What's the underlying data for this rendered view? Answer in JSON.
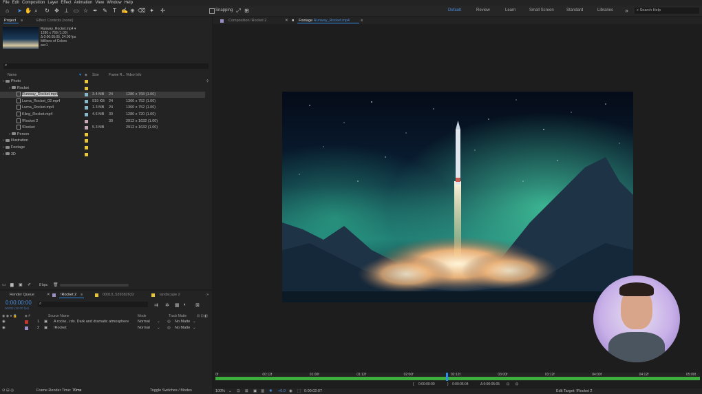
{
  "menu": [
    "File",
    "Edit",
    "Composition",
    "Layer",
    "Effect",
    "Animation",
    "View",
    "Window",
    "Help"
  ],
  "toolbar": {
    "snapping_label": "Snapping"
  },
  "workspaces": [
    "Default",
    "Review",
    "Learn",
    "Small Screen",
    "Standard",
    "Libraries"
  ],
  "search_help": "Search Help",
  "project_panel": {
    "tab_project": "Project",
    "tab_effect_controls": "Effect Controls (none)",
    "thumb_info": [
      "Runway_Rocket.mp4 ▾",
      "1280 x 768 (1.00)",
      "Δ 0:00:05:05, 24.00 fps",
      "Millions of Colors",
      "avc1"
    ],
    "columns": {
      "name": "Name",
      "size": "Size",
      "frame_rate": "Frame R...",
      "video_info": "Video Info"
    },
    "items": [
      {
        "name": "Photo",
        "type": "folder",
        "indent": 0,
        "size": "",
        "fr": "",
        "vi": "",
        "label": "#e8c53a"
      },
      {
        "name": "Rocket",
        "type": "folder",
        "indent": 1,
        "size": "",
        "fr": "",
        "vi": "",
        "label": "#e8c53a"
      },
      {
        "name": "Runway_Rocket.mp4",
        "type": "file",
        "indent": 2,
        "size": "3.4 MB",
        "fr": "24",
        "vi": "1280 x 768 (1.00)",
        "label": "#88b8c8",
        "selected": true
      },
      {
        "name": "Luma_Rocket_02.mp4",
        "type": "file",
        "indent": 2,
        "size": "919 KB",
        "fr": "24",
        "vi": "1360 x 752 (1.00)",
        "label": "#88b8c8"
      },
      {
        "name": "Luma_Rocket.mp4",
        "type": "file",
        "indent": 2,
        "size": "1.3 MB",
        "fr": "24",
        "vi": "1360 x 752 (1.00)",
        "label": "#88b8c8"
      },
      {
        "name": "Kling_Rocket.mp4",
        "type": "file",
        "indent": 2,
        "size": "4.6 MB",
        "fr": "30",
        "vi": "1280 x 720 (1.00)",
        "label": "#88b8c8"
      },
      {
        "name": "!Rocket 2",
        "type": "file",
        "indent": 2,
        "size": "",
        "fr": "30",
        "vi": "2912 x 1632 (1.00)",
        "label": "#c8a8b8"
      },
      {
        "name": "!Rocket",
        "type": "file",
        "indent": 2,
        "size": "5.3 MB",
        "fr": "",
        "vi": "2912 x 1632 (1.00)",
        "label": "#c8a8b8"
      },
      {
        "name": "Person",
        "type": "folder",
        "indent": 1,
        "size": "",
        "fr": "",
        "vi": "",
        "label": "#e8c53a"
      },
      {
        "name": "Illustration",
        "type": "folder",
        "indent": 0,
        "size": "",
        "fr": "",
        "vi": "",
        "label": "#e8c53a"
      },
      {
        "name": "Footage",
        "type": "folder",
        "indent": 0,
        "size": "",
        "fr": "",
        "vi": "",
        "label": "#e8c53a"
      },
      {
        "name": "3D",
        "type": "folder",
        "indent": 0,
        "size": "",
        "fr": "",
        "vi": "",
        "label": "#e8c53a"
      }
    ],
    "bpc": "8 bpc"
  },
  "viewer": {
    "tab_composition": "Composition !Rocket 2",
    "tab_footage_prefix": "Footage",
    "tab_footage_name": "Runway_Rocket.mp4",
    "ruler_labels": [
      "0f",
      "00:12f",
      "01:00f",
      "01:12f",
      "02:00f",
      "02:12f",
      "03:00f",
      "03:12f",
      "04:00f",
      "04:12f",
      "05:00f"
    ],
    "in_point": "0:00:00:00",
    "out_point": "0:00:05:04",
    "duration": "Δ 0:00:05:05",
    "zoom": "100%",
    "timecode": "0:00:02:07",
    "edit_target": "Edit Target: !Rocket 2"
  },
  "timeline": {
    "tab_render_queue": "Render Queue",
    "tab_rocket2": "!Rocket 2",
    "tab_00010": "00010_539382632",
    "tab_landscape": "landscape 2",
    "timecode": "0:00:00:00",
    "timecode_sub": "00000 (30.00 fps)",
    "col_source": "Source Name",
    "col_mode": "Mode",
    "col_trkmat": "Track Matte",
    "layers": [
      {
        "num": "1",
        "name": "A rocke...rds. Dark and dramatic atmosphere",
        "mode": "Normal",
        "matte": "No Matte",
        "color": "#c0392b"
      },
      {
        "num": "2",
        "name": "!Rocket",
        "mode": "Normal",
        "matte": "No Matte",
        "color": "#9b8ec4"
      }
    ],
    "frame_render": "Frame Render Time: ",
    "frame_render_value": "70ms",
    "toggle_switches": "Toggle Switches / Modes"
  },
  "colors": {
    "accent": "#2d8ceb",
    "timebar": "#3cae3c",
    "panel": "#232323"
  }
}
